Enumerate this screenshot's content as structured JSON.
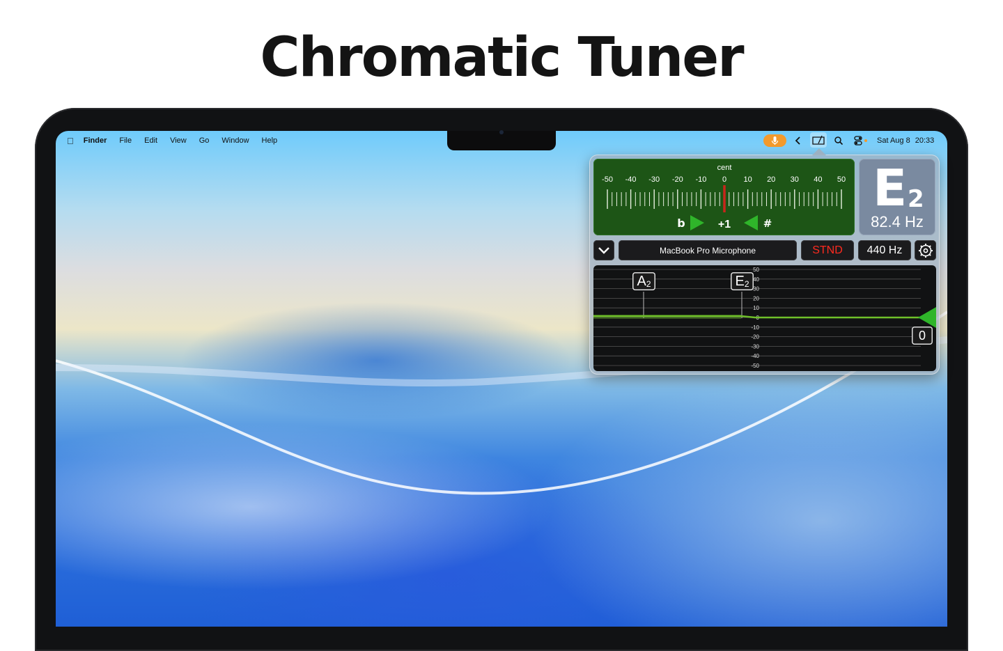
{
  "headline": "Chromatic Tuner",
  "menubar": {
    "app": "Finder",
    "items": [
      "File",
      "Edit",
      "View",
      "Go",
      "Window",
      "Help"
    ],
    "date": "Sat Aug 8",
    "time": "20:33"
  },
  "icons": {
    "apple": "apple-logo-icon",
    "mic": "microphone-icon",
    "chevron": "chevron-left-icon",
    "tuner": "tuner-menubar-icon",
    "search": "search-icon",
    "control_center": "control-center-icon",
    "dropdown": "chevron-down-icon",
    "settings": "gear-icon"
  },
  "tuner": {
    "cent_label": "cent",
    "scale_labels": [
      "-50",
      "-40",
      "-30",
      "-20",
      "-10",
      "0",
      "10",
      "20",
      "30",
      "40",
      "50"
    ],
    "flat_symbol": "b",
    "sharp_symbol": "#",
    "deviation": "+1",
    "note": {
      "letter": "E",
      "octave": "2",
      "frequency": "82.4 Hz"
    },
    "input_device": "MacBook Pro Microphone",
    "tuning_mode": "STND",
    "reference_pitch": "440 Hz",
    "graph": {
      "y_labels": [
        "50",
        "40",
        "30",
        "20",
        "10",
        "0",
        "-10",
        "-20",
        "-30",
        "-40",
        "-50"
      ],
      "markers": [
        {
          "letter": "A",
          "octave": "2"
        },
        {
          "letter": "E",
          "octave": "2"
        }
      ],
      "current_value": "0"
    }
  },
  "colors": {
    "meter_green": "#1d5516",
    "needle_red": "#c8261c",
    "indicator_green": "#2fb52a",
    "stnd_red": "#ff2a1f",
    "mic_orange": "#f39a2c"
  }
}
